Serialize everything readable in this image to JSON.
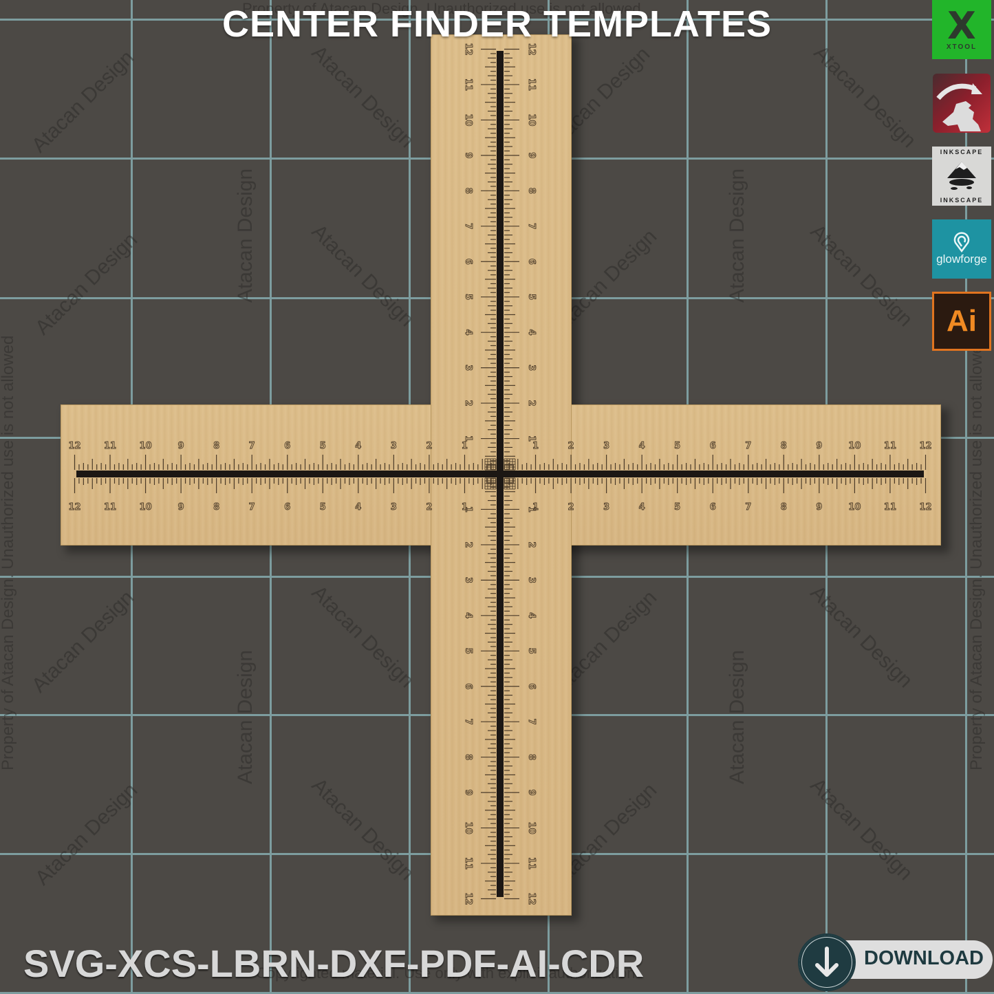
{
  "title": "CENTER FINDER TEMPLATES",
  "formats": "SVG-XCS-LBRN-DXF-PDF-AI-CDR",
  "download": {
    "label": "DOWNLOAD",
    "icon": "arrow-down-icon"
  },
  "watermarks": {
    "top_line": "Property of Atacan Design. Unauthorized use is not allowed",
    "bottom_line": "Copyrighted material. Use only with explicit authorization",
    "side_line": "Property of Atacan Design. Unauthorized use is not allowed",
    "brand": "Atacan Design"
  },
  "software_icons": [
    {
      "name": "xtool",
      "label": "XTOOL",
      "glyph": "X"
    },
    {
      "name": "lightburn",
      "label": ""
    },
    {
      "name": "inkscape",
      "label": "INKSCAPE"
    },
    {
      "name": "glowforge",
      "label": "glowforge"
    },
    {
      "name": "illustrator",
      "label": "Ai"
    }
  ],
  "colors": {
    "background": "#4c4945",
    "grid": "#7d9d9f",
    "wood": "#d9b985",
    "slot": "#1c1714",
    "ink": "#4a3a28",
    "xtool_green": "#22b52a",
    "glowforge_teal": "#1e93a2",
    "ai_orange": "#e1741f",
    "download_dark": "#1f3b41"
  },
  "ruler": {
    "units": "inch",
    "max": 12,
    "subdivisions_per_unit": 8,
    "horizontal_labels": [
      "12",
      "11",
      "10",
      "9",
      "8",
      "7",
      "6",
      "5",
      "4",
      "3",
      "2",
      "1",
      "1",
      "2",
      "3",
      "4",
      "5",
      "6",
      "7",
      "8",
      "9",
      "10",
      "11",
      "12"
    ],
    "vertical_labels": [
      "12",
      "11",
      "10",
      "9",
      "8",
      "7",
      "6",
      "5",
      "4",
      "3",
      "2",
      "1",
      "1",
      "2",
      "3",
      "4",
      "5",
      "6",
      "7",
      "8",
      "9",
      "10",
      "11",
      "12"
    ]
  }
}
